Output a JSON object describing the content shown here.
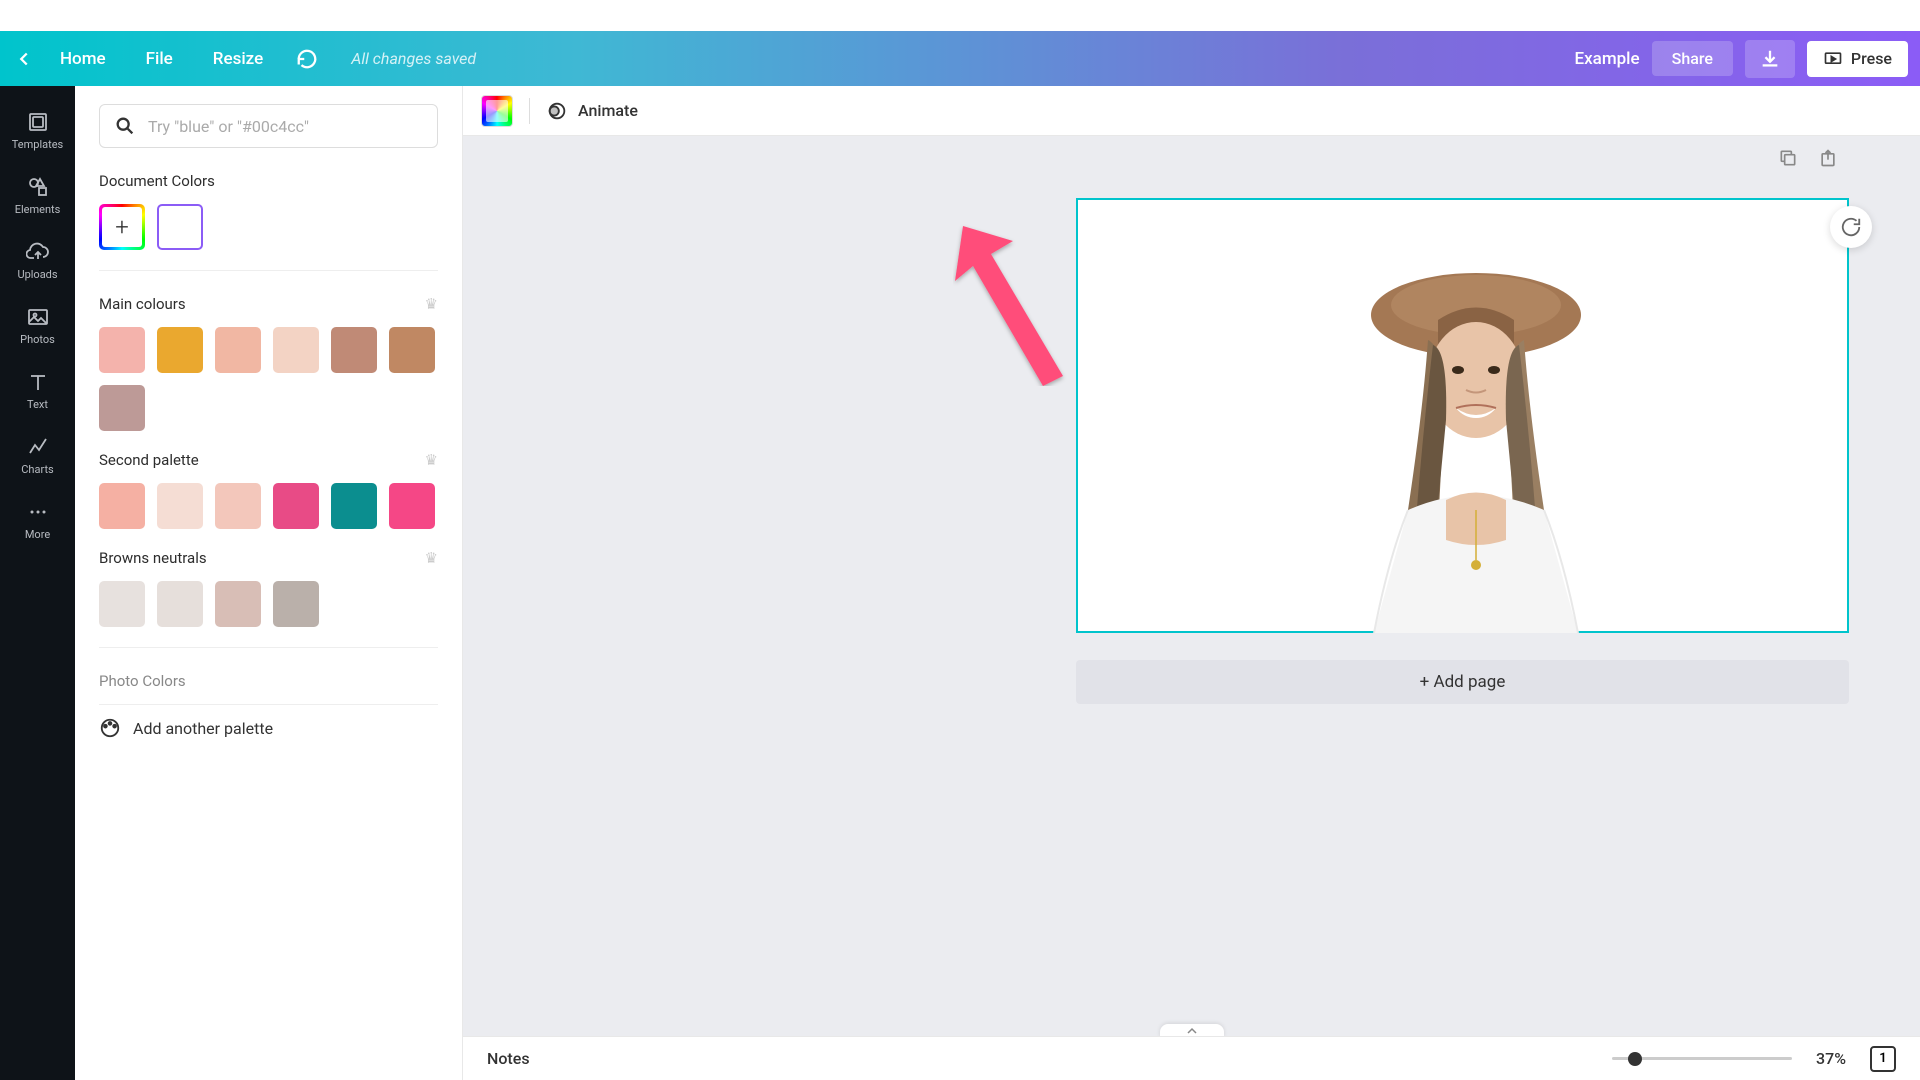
{
  "topbar": {
    "home": "Home",
    "file": "File",
    "resize": "Resize",
    "saveStatus": "All changes saved",
    "example": "Example",
    "share": "Share",
    "present": "Prese"
  },
  "sidebar": {
    "items": [
      {
        "label": "Templates"
      },
      {
        "label": "Elements"
      },
      {
        "label": "Uploads"
      },
      {
        "label": "Photos"
      },
      {
        "label": "Text"
      },
      {
        "label": "Charts"
      },
      {
        "label": "More"
      }
    ]
  },
  "colorPanel": {
    "searchPlaceholder": "Try \"blue\" or \"#00c4cc\"",
    "documentColorsTitle": "Document Colors",
    "mainColoursTitle": "Main colours",
    "mainColours": [
      "#f4b3ac",
      "#eaa82f",
      "#f1b7a3",
      "#f3d3c4",
      "#c08a76",
      "#c08863",
      "#bd9a97"
    ],
    "secondPaletteTitle": "Second palette",
    "secondPalette": [
      "#f5b0a3",
      "#f5ddd4",
      "#f3c7bb",
      "#e84b86",
      "#0b8e8f",
      "#f54786"
    ],
    "brownsTitle": "Browns neutrals",
    "brownsPalette": [
      "#e7e1de",
      "#e6dfdb",
      "#d8beb6",
      "#bab0aa"
    ],
    "photoColorsTitle": "Photo Colors",
    "addPalette": "Add another palette"
  },
  "canvasToolbar": {
    "animate": "Animate"
  },
  "canvas": {
    "addPage": "+ Add page"
  },
  "bottomBar": {
    "notes": "Notes",
    "zoom": "37%",
    "pageCount": "1"
  }
}
